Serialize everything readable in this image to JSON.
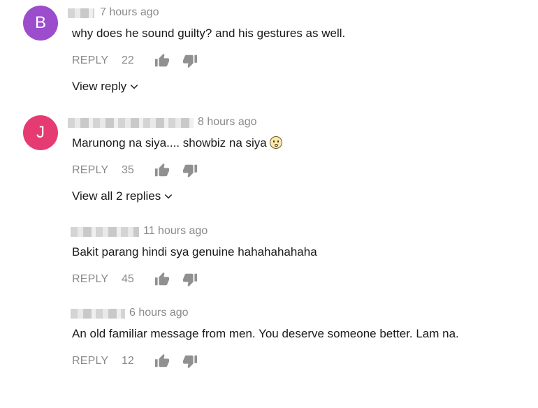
{
  "comments": [
    {
      "avatar_letter": "B",
      "avatar_color": "#9c4dcc",
      "time": "7 hours ago",
      "text": "why does he sound guilty? and his gestures as well.",
      "reply_label": "REPLY",
      "likes": "22",
      "view_replies": "View reply"
    },
    {
      "avatar_letter": "J",
      "avatar_color": "#e63b72",
      "time": "8 hours ago",
      "text": "Marunong na siya.... showbiz na siya",
      "reply_label": "REPLY",
      "likes": "35",
      "view_replies": "View all 2 replies"
    },
    {
      "time": "11 hours ago",
      "text": "Bakit parang hindi sya genuine hahahahahaha",
      "reply_label": "REPLY",
      "likes": "45"
    },
    {
      "time": "6 hours ago",
      "text": "An old familiar message from men. You deserve someone better. Lam na.",
      "reply_label": "REPLY",
      "likes": "12"
    }
  ],
  "icons": {
    "like": "thumb-up-icon",
    "dislike": "thumb-down-icon",
    "expand": "chevron-down-icon",
    "emoji": "astonished-face-emoji"
  },
  "colors": {
    "muted_text": "#8a8a8a",
    "body_text": "#1a1a1a",
    "icon": "#909090"
  }
}
